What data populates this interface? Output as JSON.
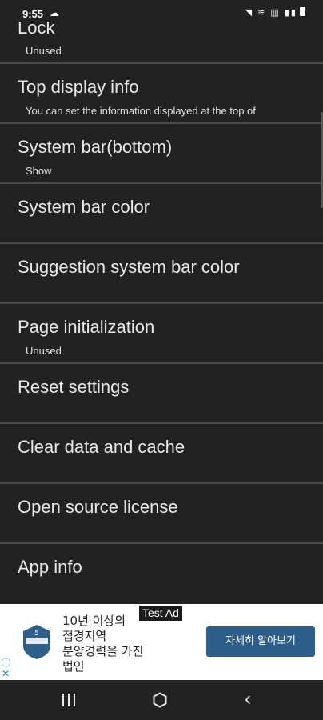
{
  "status": {
    "time": "9:55",
    "icons_text": "◥ ≋ ▥ ▮▮"
  },
  "items": [
    {
      "title": "Lock",
      "sub": "Unused"
    },
    {
      "title": "Top display info",
      "sub": "You can set the information displayed at the top of"
    },
    {
      "title": "System bar(bottom)",
      "sub": "Show"
    },
    {
      "title": "System bar color",
      "sub": ""
    },
    {
      "title": "Suggestion system bar color",
      "sub": ""
    },
    {
      "title": "Page initialization",
      "sub": "Unused"
    },
    {
      "title": "Reset settings",
      "sub": ""
    },
    {
      "title": "Clear data and cache",
      "sub": ""
    },
    {
      "title": "Open source license",
      "sub": ""
    },
    {
      "title": "App info",
      "sub": ""
    }
  ],
  "ad": {
    "label": "Test Ad",
    "lines": [
      "10년 이상의",
      "접경지역",
      "분양경력을 가진",
      "법인"
    ],
    "cta": "자세히 알아보기",
    "logo_text": "5",
    "info_icon": "info-icon",
    "close_icon": "close-icon"
  },
  "nav": {
    "recent_icon": "recent-apps-icon",
    "home_icon": "home-icon",
    "back_icon": "back-icon",
    "back_glyph": "‹"
  },
  "colors": {
    "background": "#222222",
    "divider": "#4a4a4a",
    "cta": "#2e5f8a",
    "ad_link": "#1a8fd6"
  }
}
